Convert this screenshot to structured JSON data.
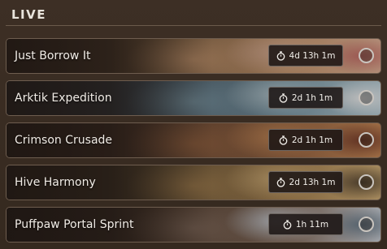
{
  "section": {
    "title": "LIVE"
  },
  "events": [
    {
      "title": "Just Borrow It",
      "timer": "4d 13h 1m",
      "timer_icon": "stopwatch-icon",
      "selected": false,
      "art_colors": [
        "#4a3a2c",
        "#8a6a48",
        "#d4a276",
        "#e3b69a",
        "#c9706a"
      ]
    },
    {
      "title": "Arktik Expedition",
      "timer": "2d 1h 1m",
      "timer_icon": "stopwatch-icon",
      "selected": false,
      "art_colors": [
        "#2f3a44",
        "#4b6374",
        "#7fa3b4",
        "#b8d0da",
        "#f0f4f6"
      ]
    },
    {
      "title": "Crimson Crusade",
      "timer": "2d 1h 1m",
      "timer_icon": "stopwatch-icon",
      "selected": false,
      "art_colors": [
        "#3a2a22",
        "#6a4a36",
        "#a06a44",
        "#c98a56",
        "#7a3e2a"
      ]
    },
    {
      "title": "Hive Harmony",
      "timer": "2d 13h 1m",
      "timer_icon": "stopwatch-icon",
      "selected": false,
      "art_colors": [
        "#3a3226",
        "#6e5a3a",
        "#b08a54",
        "#d8b57a",
        "#5a4a34"
      ]
    },
    {
      "title": "Puffpaw Portal Sprint",
      "timer": "1h 11m",
      "timer_icon": "stopwatch-icon",
      "selected": false,
      "art_colors": [
        "#2c2622",
        "#5a4434",
        "#8a7262",
        "#cfd6de",
        "#6a7e8e"
      ]
    }
  ]
}
